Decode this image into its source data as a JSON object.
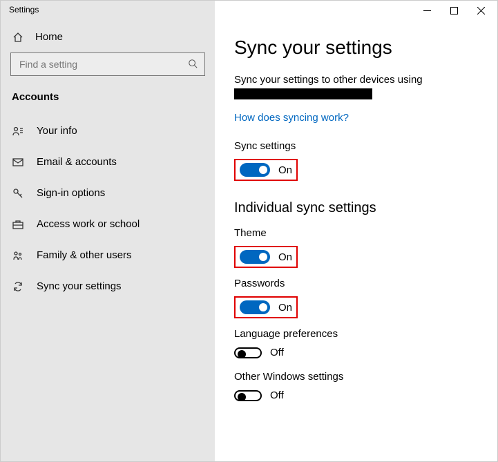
{
  "window": {
    "title": "Settings"
  },
  "sidebar": {
    "home": "Home",
    "search_placeholder": "Find a setting",
    "section": "Accounts",
    "items": [
      {
        "label": "Your info"
      },
      {
        "label": "Email & accounts"
      },
      {
        "label": "Sign-in options"
      },
      {
        "label": "Access work or school"
      },
      {
        "label": "Family & other users"
      },
      {
        "label": "Sync your settings"
      }
    ]
  },
  "page": {
    "title": "Sync your settings",
    "desc": "Sync your settings to other devices using",
    "link": "How does syncing work?",
    "sync_settings_label": "Sync settings",
    "sync_settings_state": "On",
    "individual_heading": "Individual sync settings",
    "toggles": {
      "theme": {
        "label": "Theme",
        "state": "On"
      },
      "passwords": {
        "label": "Passwords",
        "state": "On"
      },
      "language": {
        "label": "Language preferences",
        "state": "Off"
      },
      "other": {
        "label": "Other Windows settings",
        "state": "Off"
      }
    }
  }
}
